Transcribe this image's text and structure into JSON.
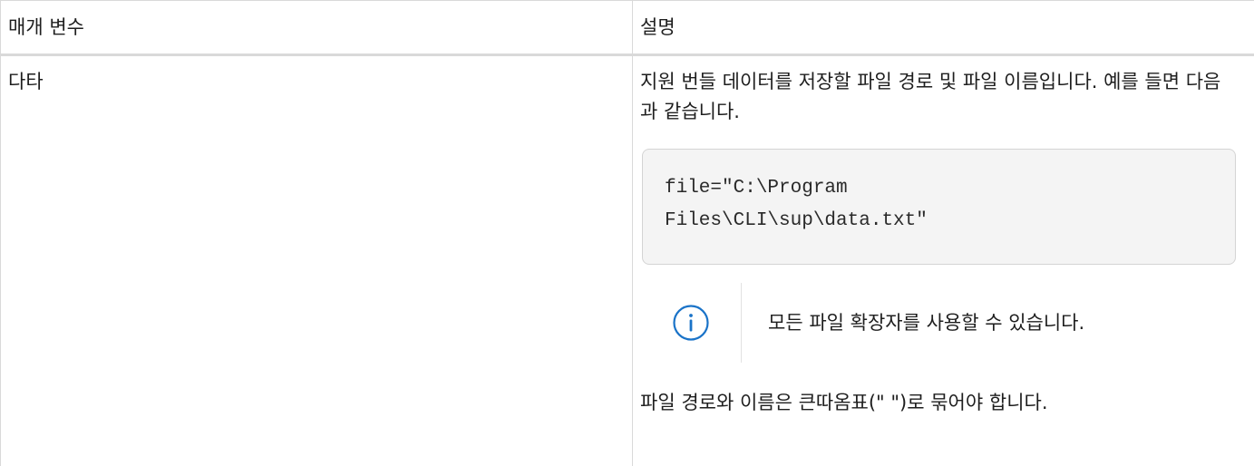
{
  "table": {
    "header": {
      "param": "매개 변수",
      "desc": "설명"
    },
    "rows": [
      {
        "param": "다타",
        "desc": {
          "text": "지원 번들 데이터를 저장할 파일 경로 및 파일 이름입니다. 예를 들면 다음과 같습니다.",
          "code": "file=\"C:\\Program\nFiles\\CLI\\sup\\data.txt\"",
          "note_icon": "info-circle-icon",
          "note": "모든 파일 확장자를 사용할 수 있습니다.",
          "footer": "파일 경로와 이름은 큰따옴표(\" \")로 묶어야 합니다."
        }
      }
    ]
  },
  "colors": {
    "info_icon": "#1a73c8",
    "border": "#d9d9d9",
    "code_bg": "#f4f4f4"
  }
}
